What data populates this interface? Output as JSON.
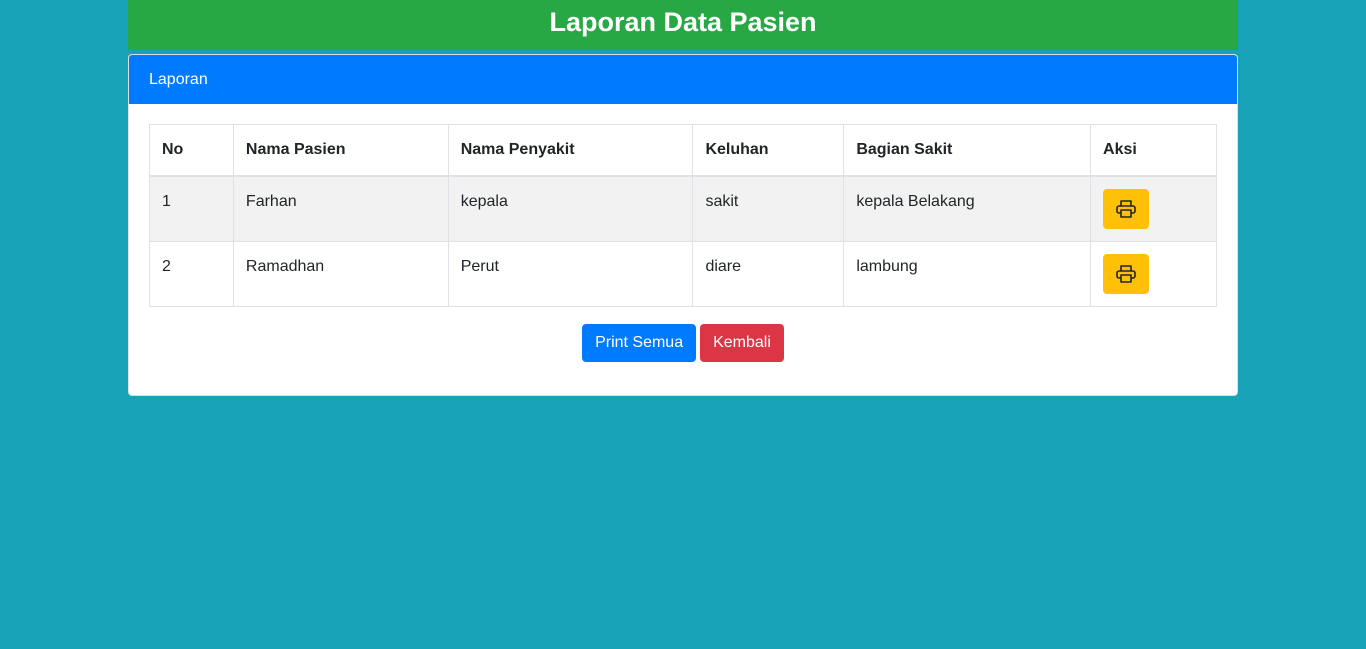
{
  "page": {
    "title": "Laporan Data Pasien"
  },
  "card": {
    "header": "Laporan"
  },
  "table": {
    "headers": [
      "No",
      "Nama Pasien",
      "Nama Penyakit",
      "Keluhan",
      "Bagian Sakit",
      "Aksi"
    ],
    "rows": [
      {
        "no": "1",
        "nama_pasien": "Farhan",
        "nama_penyakit": "kepala",
        "keluhan": "sakit",
        "bagian_sakit": "kepala Belakang",
        "aksi_icon": "printer-icon"
      },
      {
        "no": "2",
        "nama_pasien": "Ramadhan",
        "nama_penyakit": "Perut",
        "keluhan": "diare",
        "bagian_sakit": "lambung",
        "aksi_icon": "printer-icon"
      }
    ]
  },
  "actions": {
    "print_all_label": "Print Semua",
    "back_label": "Kembali"
  },
  "colors": {
    "background": "#17a2b8",
    "header_green": "#28a745",
    "card_header_blue": "#007bff",
    "print_button_yellow": "#ffc107",
    "primary": "#007bff",
    "danger": "#dc3545"
  }
}
